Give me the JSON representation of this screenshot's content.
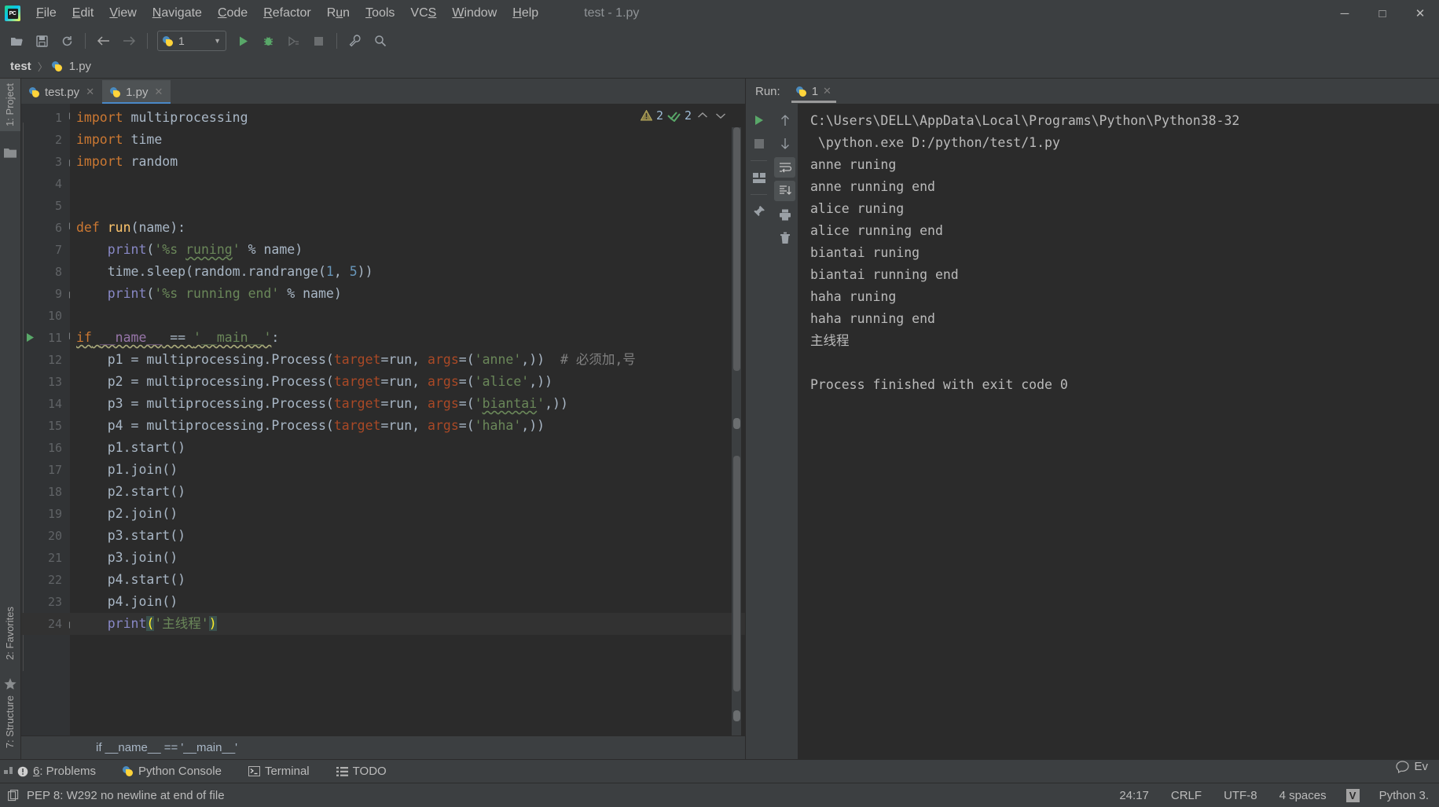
{
  "window": {
    "title": "test - 1.py",
    "minimize": "─",
    "maximize": "□",
    "close": "✕"
  },
  "menu": {
    "items": [
      {
        "label": "File",
        "mnemonic": "F"
      },
      {
        "label": "Edit",
        "mnemonic": "E"
      },
      {
        "label": "View",
        "mnemonic": "V"
      },
      {
        "label": "Navigate",
        "mnemonic": "N"
      },
      {
        "label": "Code",
        "mnemonic": "C"
      },
      {
        "label": "Refactor",
        "mnemonic": "R"
      },
      {
        "label": "Run",
        "mnemonic": "u"
      },
      {
        "label": "Tools",
        "mnemonic": "T"
      },
      {
        "label": "VCS",
        "mnemonic": "S"
      },
      {
        "label": "Window",
        "mnemonic": "W"
      },
      {
        "label": "Help",
        "mnemonic": "H"
      }
    ]
  },
  "toolbar": {
    "open_icon": "open-folder-icon",
    "save_icon": "save-icon",
    "sync_icon": "sync-icon",
    "back_icon": "back-arrow-icon",
    "forward_icon": "forward-arrow-icon",
    "run_config_label": "1",
    "run_icon": "run-icon",
    "debug_icon": "debug-icon",
    "coverage_icon": "run-with-coverage-icon",
    "stop_icon": "stop-icon",
    "settings_icon": "wrench-icon",
    "search_icon": "search-icon"
  },
  "breadcrumb": {
    "project": "test",
    "file": "1.py",
    "separator": "〉"
  },
  "left_strip": {
    "project": "1: Project",
    "favorites": "2: Favorites",
    "structure": "7: Structure"
  },
  "editor": {
    "tabs": [
      {
        "label": "test.py",
        "active": false
      },
      {
        "label": "1.py",
        "active": true
      }
    ],
    "inspection": {
      "warning_count": "2",
      "ok_count": "2",
      "up_arrow": "⌃",
      "down_arrow": "⌄"
    },
    "bottom_breadcrumb": "if __name__ == '__main__'",
    "lines": [
      {
        "num": "1",
        "fold": "minus-round"
      },
      {
        "num": "2",
        "fold": ""
      },
      {
        "num": "3",
        "fold": "end"
      },
      {
        "num": "4",
        "fold": ""
      },
      {
        "num": "5",
        "fold": ""
      },
      {
        "num": "6",
        "fold": "minus-round"
      },
      {
        "num": "7",
        "fold": ""
      },
      {
        "num": "8",
        "fold": ""
      },
      {
        "num": "9",
        "fold": "end"
      },
      {
        "num": "10",
        "fold": ""
      },
      {
        "num": "11",
        "fold": "minus-round",
        "runmark": true
      },
      {
        "num": "12",
        "fold": ""
      },
      {
        "num": "13",
        "fold": ""
      },
      {
        "num": "14",
        "fold": ""
      },
      {
        "num": "15",
        "fold": ""
      },
      {
        "num": "16",
        "fold": ""
      },
      {
        "num": "17",
        "fold": ""
      },
      {
        "num": "18",
        "fold": ""
      },
      {
        "num": "19",
        "fold": ""
      },
      {
        "num": "20",
        "fold": ""
      },
      {
        "num": "21",
        "fold": ""
      },
      {
        "num": "22",
        "fold": ""
      },
      {
        "num": "23",
        "fold": ""
      },
      {
        "num": "24",
        "fold": "end",
        "bulb": true
      }
    ],
    "code_text": [
      "import multiprocessing",
      "import time",
      "import random",
      "",
      "",
      "def run(name):",
      "    print('%s runing' % name)",
      "    time.sleep(random.randrange(1, 5))",
      "    print('%s running end' % name)",
      "",
      "if __name__ == '__main__':",
      "    p1 = multiprocessing.Process(target=run, args=('anne',))  # 必须加,号",
      "    p2 = multiprocessing.Process(target=run, args=('alice',))",
      "    p3 = multiprocessing.Process(target=run, args=('biantai',))",
      "    p4 = multiprocessing.Process(target=run, args=('haha',))",
      "    p1.start()",
      "    p1.join()",
      "    p2.start()",
      "    p2.join()",
      "    p3.start()",
      "    p3.join()",
      "    p4.start()",
      "    p4.join()",
      "    print('主线程')"
    ]
  },
  "run_panel": {
    "label": "Run:",
    "tab_label": "1",
    "side_buttons": [
      "rerun-icon",
      "stop-icon",
      "layout-icon",
      "pin-tab-icon"
    ],
    "side_buttons2": [
      "up-arrow-icon",
      "down-arrow-icon",
      "soft-wrap-icon",
      "scroll-to-end-icon",
      "print-icon",
      "clear-all-icon"
    ],
    "console_lines": [
      "C:\\Users\\DELL\\AppData\\Local\\Programs\\Python\\Python38-32",
      " \\python.exe D:/python/test/1.py",
      "anne runing",
      "anne running end",
      "alice runing",
      "alice running end",
      "biantai runing",
      "biantai running end",
      "haha runing",
      "haha running end",
      "主线程",
      "",
      "Process finished with exit code 0"
    ]
  },
  "tool_windows": [
    {
      "label": "6: Problems",
      "mnemonic": "6",
      "icon": "problems-icon"
    },
    {
      "label": "Python Console",
      "icon": "python-icon"
    },
    {
      "label": "Terminal",
      "icon": "terminal-icon"
    },
    {
      "label": "TODO",
      "icon": "todo-icon"
    }
  ],
  "status_bar": {
    "message": "PEP 8: W292 no newline at end of file",
    "message_icon": "copy-icon",
    "caret": "24:17",
    "line_separator": "CRLF",
    "encoding": "UTF-8",
    "indent": "4 spaces",
    "vcs_badge": "V",
    "interpreter": "Python 3.",
    "event_log": "Ev",
    "event_icon": "event-log-icon"
  },
  "colors": {
    "chrome": "#3c3f41",
    "editor_bg": "#2b2b2b",
    "gutter_bg": "#313335",
    "accent_tab": "#4a88c7",
    "keyword": "#cc7832",
    "string": "#6a8759",
    "number": "#6897bb",
    "function": "#ffc66d",
    "comment": "#808080",
    "named_arg": "#aa4926",
    "builtin": "#8888c6",
    "text": "#a9b7c6",
    "run_green": "#59a869",
    "warn_yellow": "#bbb529"
  }
}
